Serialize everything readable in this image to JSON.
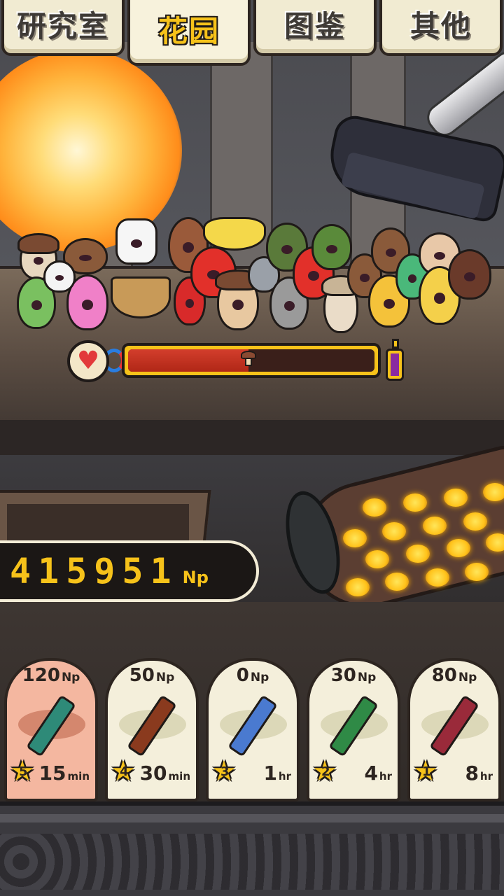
{
  "tabs": [
    {
      "label": "研究室"
    },
    {
      "label": "花园"
    },
    {
      "label": "图鉴"
    },
    {
      "label": "其他"
    }
  ],
  "active_tab": "花园",
  "health": {
    "fill_fraction": 0.49
  },
  "np_counter": {
    "value": "415951",
    "unit": "Np"
  },
  "items": [
    {
      "price": "120",
      "price_unit": "Np",
      "rank": "5",
      "time": "15",
      "time_unit": "min",
      "bottle_color": "#2e8a78",
      "selected": true
    },
    {
      "price": "50",
      "price_unit": "Np",
      "rank": "4",
      "time": "30",
      "time_unit": "min",
      "bottle_color": "#8a3a1e",
      "selected": false
    },
    {
      "price": "0",
      "price_unit": "Np",
      "rank": "3",
      "time": "1",
      "time_unit": "hr",
      "bottle_color": "#4a7ad0",
      "selected": false
    },
    {
      "price": "30",
      "price_unit": "Np",
      "rank": "2",
      "time": "4",
      "time_unit": "hr",
      "bottle_color": "#2f8a46",
      "selected": false
    },
    {
      "price": "80",
      "price_unit": "Np",
      "rank": "1",
      "time": "8",
      "time_unit": "hr",
      "bottle_color": "#9a2a3a",
      "selected": false
    }
  ],
  "colors": {
    "accent_yellow": "#f6c21a",
    "health_red": "#d33e2c",
    "card_bg": "#f4efdb",
    "card_selected_bg": "#f4b7a0"
  }
}
